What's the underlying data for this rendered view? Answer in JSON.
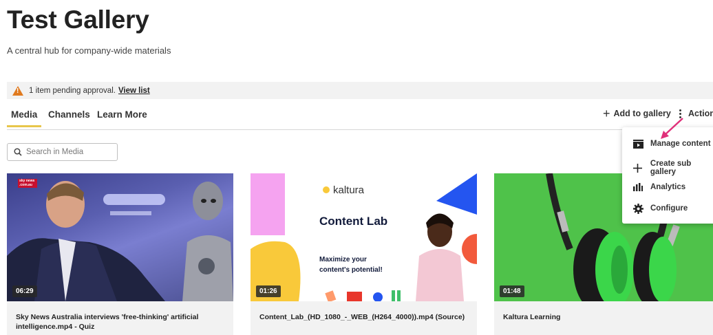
{
  "page": {
    "title": "Test Gallery",
    "subtitle": "A central hub for company-wide materials"
  },
  "notice": {
    "text": "1 item pending approval.",
    "link": "View list",
    "icon": "warning-icon"
  },
  "tabs": [
    {
      "label": "Media",
      "active": true
    },
    {
      "label": "Channels",
      "active": false
    },
    {
      "label": "Learn More",
      "active": false
    }
  ],
  "toolbar": {
    "add_label": "Add to gallery",
    "actions_label": "Actions"
  },
  "search": {
    "placeholder": "Search in Media",
    "value": ""
  },
  "actions_menu": [
    {
      "label": "Manage content",
      "icon": "manage-content-icon"
    },
    {
      "label": "Create sub gallery",
      "icon": "plus-icon"
    },
    {
      "label": "Analytics",
      "icon": "bar-chart-icon"
    },
    {
      "label": "Configure",
      "icon": "gear-icon"
    }
  ],
  "media": [
    {
      "title": "Sky News Australia interviews 'free-thinking' artificial intelligence.mp4 - Quiz",
      "duration": "06:29",
      "thumb_badge": "sky news .com.au"
    },
    {
      "title": "Content_Lab_(HD_1080_-_WEB_(H264_4000)).mp4 (Source)",
      "duration": "01:26",
      "thumb_brand": "kaltura",
      "thumb_heading": "Content Lab",
      "thumb_tagline": "Maximize your content's potential!"
    },
    {
      "title": "Kaltura Learning",
      "duration": "01:48"
    }
  ],
  "colors": {
    "active_tab_underline": "#e8c64a",
    "warning": "#e07a1f",
    "annotation_arrow": "#e0307a"
  }
}
